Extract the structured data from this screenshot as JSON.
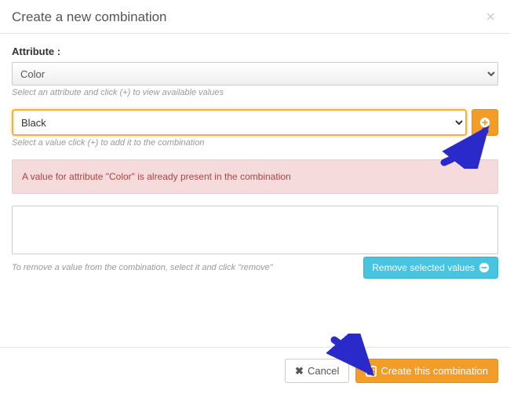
{
  "modal": {
    "title": "Create a new combination",
    "close_glyph": "×"
  },
  "attribute": {
    "label": "Attribute :",
    "selected": "Color",
    "hint": "Select an attribute and click (+) to view available values"
  },
  "value": {
    "selected": "Black",
    "hint": "Select a value click (+) to add it to the combination"
  },
  "alert": {
    "message": "A value for attribute \"Color\" is already present in the combination"
  },
  "combination_list": {
    "hint": "To remove a value from the combination, select it and click \"remove\"",
    "remove_label": "Remove selected values"
  },
  "footer": {
    "cancel_label": "Cancel",
    "create_label": "Create this combination"
  },
  "colors": {
    "accent": "#f39c28",
    "info": "#47c4e0",
    "danger_bg": "#f5dbdb",
    "danger_text": "#a94442"
  }
}
